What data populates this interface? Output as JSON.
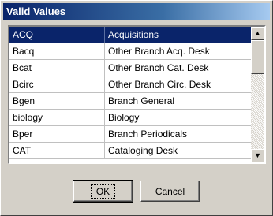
{
  "window": {
    "title": "Valid Values"
  },
  "list": {
    "rows": [
      {
        "code": "ACQ",
        "description": "Acquisitions",
        "selected": true
      },
      {
        "code": "Bacq",
        "description": "Other Branch Acq. Desk"
      },
      {
        "code": "Bcat",
        "description": "Other Branch Cat. Desk"
      },
      {
        "code": "Bcirc",
        "description": "Other Branch Circ. Desk"
      },
      {
        "code": "Bgen",
        "description": "Branch General"
      },
      {
        "code": "biology",
        "description": "Biology"
      },
      {
        "code": "Bper",
        "description": "Branch Periodicals"
      },
      {
        "code": "CAT",
        "description": "Cataloging Desk"
      }
    ],
    "scrollbar": {
      "up_icon": "arrow-up-icon",
      "down_icon": "arrow-down-icon",
      "position": 0.0
    }
  },
  "buttons": {
    "ok": {
      "mnemonic": "O",
      "rest": "K"
    },
    "cancel": {
      "mnemonic": "C",
      "rest": "ancel"
    }
  },
  "colors": {
    "title_start": "#0a246a",
    "title_end": "#a6caf0",
    "selection": "#0a246a",
    "face": "#d4d0c8"
  }
}
